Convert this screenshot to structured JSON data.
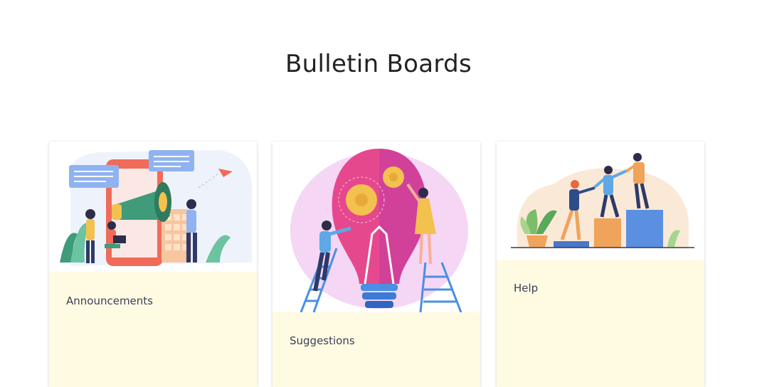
{
  "page": {
    "title": "Bulletin Boards"
  },
  "boards": [
    {
      "label": "Announcements",
      "illustration": "megaphone-illustration"
    },
    {
      "label": "Suggestions",
      "illustration": "lightbulb-illustration"
    },
    {
      "label": "Help",
      "illustration": "teamwork-steps-illustration"
    }
  ],
  "colors": {
    "card_footer": "#fffbe3",
    "title_text": "#222222",
    "label_text": "#3a3f58"
  }
}
